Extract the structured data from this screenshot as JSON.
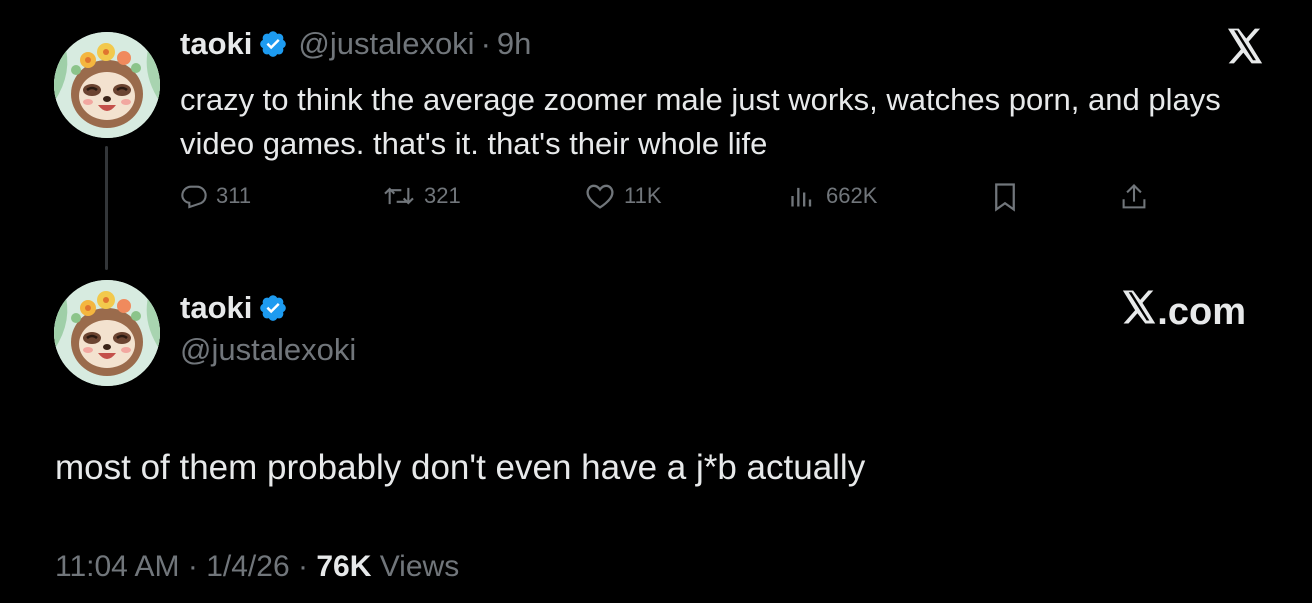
{
  "original_tweet": {
    "author_name": "taoki",
    "handle": "@justalexoki",
    "separator": "·",
    "relative_time": "9h",
    "text": "crazy to think the average zoomer male just works, watches porn, and plays video games. that's it. that's their whole life",
    "metrics": {
      "replies": "311",
      "reposts": "321",
      "likes": "11K",
      "views": "662K"
    }
  },
  "reply_tweet": {
    "author_name": "taoki",
    "handle": "@justalexoki",
    "text": "most of them probably don't even have a j*b actually",
    "timestamp": "11:04 AM",
    "date": "1/4/26",
    "separator": "·",
    "views_count": "76K",
    "views_label": "Views"
  },
  "branding": {
    "x_logo_icon": "x-logo-icon",
    "xcom_suffix": ".com"
  },
  "colors": {
    "background": "#000000",
    "primary_text": "#e7e9ea",
    "secondary_text": "#71767b",
    "verified_blue": "#1d9bf0",
    "thread_line": "#333639"
  }
}
